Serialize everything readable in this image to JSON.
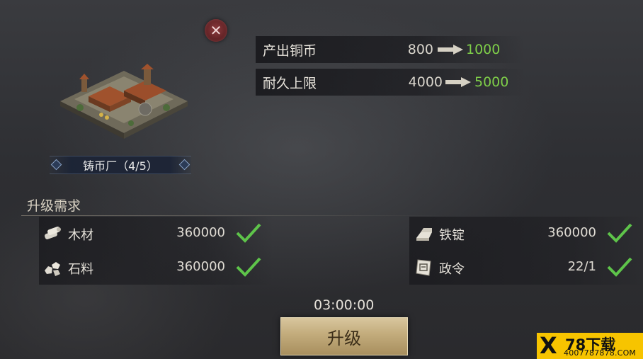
{
  "close": {
    "label": "✕"
  },
  "stats": [
    {
      "label": "产出铜币",
      "old": "800",
      "new": "1000"
    },
    {
      "label": "耐久上限",
      "old": "4000",
      "new": "5000"
    }
  ],
  "building": {
    "name": "铸币厂（4/5）"
  },
  "requirements": {
    "title": "升级需求",
    "items": [
      {
        "icon": "wood-icon",
        "name": "木材",
        "amount": "360000",
        "met": true
      },
      {
        "icon": "iron-ingot-icon",
        "name": "铁锭",
        "amount": "360000",
        "met": true
      },
      {
        "icon": "stone-icon",
        "name": "石料",
        "amount": "360000",
        "met": true
      },
      {
        "icon": "decree-icon",
        "name": "政令",
        "amount": "22/1",
        "met": true
      }
    ]
  },
  "timer": "03:00:00",
  "upgrade_button": "升级",
  "watermark": {
    "mark": "X",
    "title": "78下载",
    "url": "4007787878.COM"
  },
  "colors": {
    "increase": "#7fcf49",
    "check": "#5ec44a",
    "button": "#c2ab7b"
  }
}
